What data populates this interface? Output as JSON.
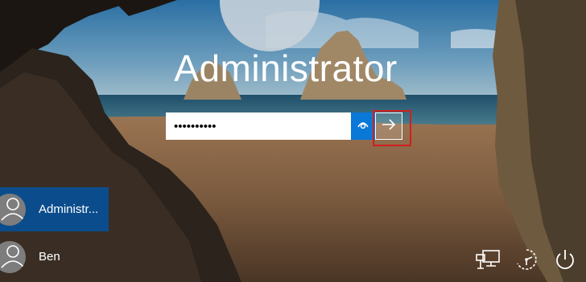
{
  "login": {
    "username": "Administrator",
    "password_value": "Pass123456",
    "reveal_icon": "eye-icon",
    "submit_icon": "arrow-right-icon",
    "highlight_color": "#d21f1f"
  },
  "users": [
    {
      "name": "Administrator",
      "display": "Administr...",
      "selected": true
    },
    {
      "name": "Ben",
      "display": "Ben",
      "selected": false
    }
  ],
  "system_icons": [
    "network-icon",
    "ease-of-access-icon",
    "power-icon"
  ],
  "colors": {
    "accent": "#0a78d7",
    "selected_user": "#0b4d8c"
  }
}
